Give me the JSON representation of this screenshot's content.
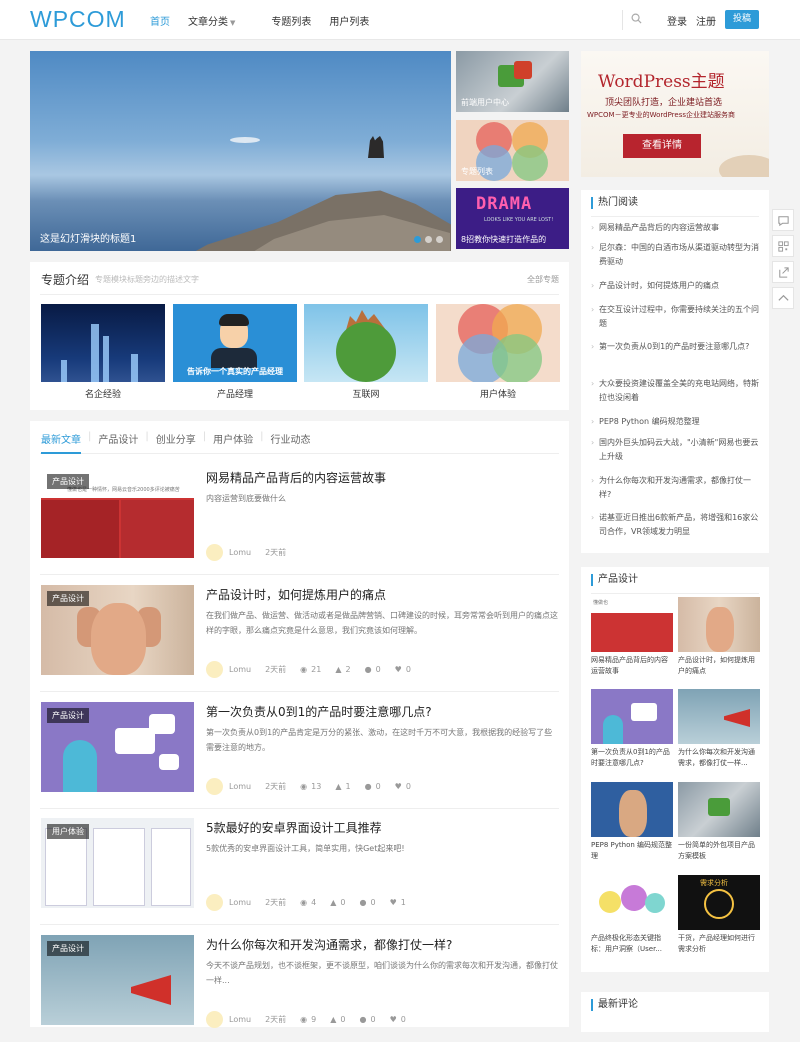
{
  "header": {
    "logo": "WPCOM",
    "nav": [
      "首页",
      "文章分类",
      "专题列表",
      "用户列表"
    ],
    "login": "登录",
    "register": "注册",
    "post_button": "投稿",
    "accent_color": "#2d9bd8"
  },
  "slider": {
    "caption": "这是幻灯滑块的标题1",
    "dots": 3,
    "active_dot": 1
  },
  "side_thumbs": [
    "前端用户中心",
    "专题列表",
    "8招教你快速打造作品的"
  ],
  "side_thumb3_art": {
    "word": "DRAMA",
    "subtitle": "LOOKS LIKE YOU ARE LOST!"
  },
  "ad": {
    "title": "WordPress主题",
    "subtitle": "顶尖团队打造，企业建站首选",
    "line": "WPCOM－更专业的WordPress企业建站服务商",
    "button": "查看详情"
  },
  "topics": {
    "heading": "专题介绍",
    "desc": "专题模块标题旁边的描述文字",
    "all": "全部专题",
    "items": [
      "名企经验",
      "产品经理",
      "互联网",
      "用户体验"
    ],
    "banner_text": "告诉你一个真实的产品经理"
  },
  "articles": {
    "tabs": [
      "最新文章",
      "产品设计",
      "创业分享",
      "用户体验",
      "行业动态"
    ],
    "list": [
      {
        "tag": "产品设计",
        "title": "网易精品产品背后的内容运营故事",
        "desc": "内容运营到底要做什么",
        "author": "Lomu",
        "time": "2天前",
        "views": "",
        "likes": "",
        "comments": "",
        "favs": "",
        "img_text": "懂做也是一种情怀，网易云音乐2000多评论被痛苦"
      },
      {
        "tag": "产品设计",
        "title": "产品设计时，如何提炼用户的痛点",
        "desc": "在我们做产品、做运营、做活动或者是做品牌营销、口碑建设的时候，耳旁常常会听到用户的痛点这样的字眼，那么痛点究竟是什么意思，我们究竟该如何理解。",
        "author": "Lomu",
        "time": "2天前",
        "views": "21",
        "likes": "2",
        "comments": "0",
        "favs": "0"
      },
      {
        "tag": "产品设计",
        "title": "第一次负责从0到1的产品时要注意哪几点?",
        "desc": "第一次负责从0到1的产品肯定是万分的紧张、激动，在这时千万不可大意，我根据我的经验写了些需要注意的地方。",
        "author": "Lomu",
        "time": "2天前",
        "views": "13",
        "likes": "1",
        "comments": "0",
        "favs": "0"
      },
      {
        "tag": "用户体验",
        "title": "5款最好的安卓界面设计工具推荐",
        "desc": "5款优秀的安卓界面设计工具，简单实用，快Get起来吧!",
        "author": "Lomu",
        "time": "2天前",
        "views": "4",
        "likes": "0",
        "comments": "0",
        "favs": "1"
      },
      {
        "tag": "产品设计",
        "title": "为什么你每次和开发沟通需求，都像打仗一样?",
        "desc": "今天不谈产品规划，也不谈框架，更不谈原型，咱们谈谈为什么你的需求每次和开发沟通，都像打仗一样...",
        "author": "Lomu",
        "time": "2天前",
        "views": "9",
        "likes": "0",
        "comments": "0",
        "favs": "0"
      }
    ]
  },
  "hot": {
    "heading": "热门阅读",
    "items": [
      "网易精品产品背后的内容运营故事",
      "尼尔森：中国的白酒市场从渠道驱动转型为消费驱动",
      "产品设计时，如何提炼用户的痛点",
      "在交互设计过程中，你需要持续关注的五个问题",
      "第一次负责从0到1的产品时要注意哪几点?",
      "大众要投资建设覆盖全美的充电站网络，特斯拉也没闲着",
      "PEP8 Python 编码规范整理",
      "国内外巨头加码云大战，\"小清新\"网易也要云上升级",
      "为什么你每次和开发沟通需求，都像打仗一样?",
      "诺基亚近日推出6款新产品，将增强和16家公司合作，VR领域发力明显"
    ]
  },
  "product_design": {
    "heading": "产品设计",
    "items": [
      "网易精品产品背后的内容运营故事",
      "产品设计时，如何提炼用户的痛点",
      "第一次负责从0到1的产品时要注意哪几点?",
      "为什么你每次和开发沟通需求，都像打仗一样...",
      "PEP8 Python 编码规范整理",
      "一份简单的外包项目产品方案模板",
      "产品终极化形态关键指标：用户洞察（User...",
      "干货，产品经理如何进行需求分析"
    ],
    "img_text": [
      "懂做也",
      "需求分析"
    ]
  },
  "comments": {
    "heading": "最新评论"
  }
}
